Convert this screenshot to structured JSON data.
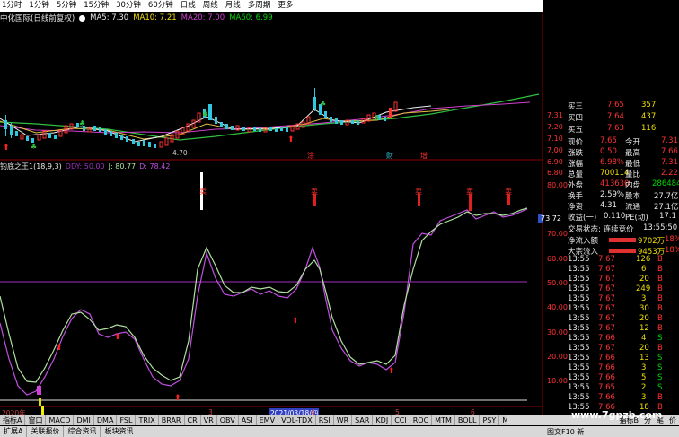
{
  "periods": [
    "1分时",
    "1分钟",
    "5分钟",
    "15分钟",
    "30分钟",
    "60分钟",
    "日线",
    "周线",
    "月线",
    "多周期",
    "更多"
  ],
  "info_line": {
    "title": "中化国际(日线前复权)",
    "ma5": "MA5: 7.30",
    "ma10": "MA10: 7.21",
    "ma20": "MA20: 7.00",
    "ma60": "MA60: 6.99",
    "low_label": "4.70"
  },
  "indicator_line": {
    "name": "钓底之王1(18,9,3)",
    "ddy": "DDY: 50.00",
    "j": "J: 80.77",
    "d": "D: 78.42"
  },
  "sell_label": "卖",
  "buy_label": "买",
  "marks": {
    "tuo": "涂",
    "cai": "财",
    "zeng": "增"
  },
  "price_axis": [
    "7.31",
    "7.20",
    "7.10",
    "7.00",
    "6.90",
    "6.80"
  ],
  "ind_axis": [
    "80.00",
    "73.72",
    "70.00",
    "60.00",
    "50.00",
    "40.00",
    "30.00",
    "20.00",
    "10.00"
  ],
  "time_axis": {
    "year": "2020年",
    "date": "2021/03/18/四",
    "ticks": [
      "3",
      "4",
      "5",
      "6"
    ]
  },
  "quote": {
    "rows": [
      {
        "label": "买三",
        "price": "7.65",
        "vol": "357"
      },
      {
        "label": "买四",
        "price": "7.64",
        "vol": "437"
      },
      {
        "label": "买五",
        "price": "7.63",
        "vol": "116"
      }
    ],
    "stats": [
      {
        "l1": "现价",
        "v1": "7.65",
        "l2": "今开",
        "v2": "7.31"
      },
      {
        "l1": "涨跌",
        "v1": "0.50",
        "l2": "最高",
        "v2": "7.66"
      },
      {
        "l1": "涨幅",
        "v1": "6.98%",
        "l2": "最低",
        "v2": "7.31"
      },
      {
        "l1": "总量",
        "v1": "700114",
        "l2": "量比",
        "v2": "2.22"
      },
      {
        "l1": "外盘",
        "v1": "413630",
        "l2": "内盘",
        "v2": "286484"
      },
      {
        "l1": "换手",
        "v1": "2.59%",
        "l2": "股本",
        "v2": "27.7亿"
      },
      {
        "l1": "净资",
        "v1": "4.31",
        "l2": "流通",
        "v2": "27.1亿"
      },
      {
        "l1": "收益(一)",
        "v1": "0.110",
        "l2": "PE(动)",
        "v2": "17.1"
      }
    ],
    "trade_status_label": "交易状态: 连续竞价",
    "trade_status_time": "13:55:50",
    "flows": [
      {
        "label": "净流入额",
        "value": "9702万",
        "pct": "18%"
      },
      {
        "label": "大宗流入",
        "value": "9453万",
        "pct": "18%"
      }
    ]
  },
  "trades": [
    {
      "time": "13:55",
      "price": "7.67",
      "vol": "126",
      "side": "B"
    },
    {
      "time": "13:55",
      "price": "7.67",
      "vol": "6",
      "side": "B"
    },
    {
      "time": "13:55",
      "price": "7.67",
      "vol": "20",
      "side": "B"
    },
    {
      "time": "13:55",
      "price": "7.67",
      "vol": "249",
      "side": "B"
    },
    {
      "time": "13:55",
      "price": "7.67",
      "vol": "3",
      "side": "B"
    },
    {
      "time": "13:55",
      "price": "7.67",
      "vol": "30",
      "side": "B"
    },
    {
      "time": "13:55",
      "price": "7.67",
      "vol": "20",
      "side": "B"
    },
    {
      "time": "13:55",
      "price": "7.67",
      "vol": "12",
      "side": "B"
    },
    {
      "time": "13:55",
      "price": "7.66",
      "vol": "4",
      "side": "S"
    },
    {
      "time": "13:55",
      "price": "7.67",
      "vol": "20",
      "side": "B"
    },
    {
      "time": "13:55",
      "price": "7.66",
      "vol": "13",
      "side": "S"
    },
    {
      "time": "13:55",
      "price": "7.66",
      "vol": "3",
      "side": "S"
    },
    {
      "time": "13:55",
      "price": "7.66",
      "vol": "5",
      "side": "S"
    },
    {
      "time": "13:55",
      "price": "7.65",
      "vol": "2",
      "side": "S"
    },
    {
      "time": "13:55",
      "price": "7.66",
      "vol": "3",
      "side": "B"
    },
    {
      "time": "13:55",
      "price": "7.66",
      "vol": "18",
      "side": "B"
    }
  ],
  "indicator_tabs": [
    "指标A",
    "窗口",
    "MACD",
    "DMI",
    "DMA",
    "FSL",
    "TRIX",
    "BRAR",
    "CR",
    "VR",
    "OBV",
    "ASI",
    "EMV",
    "VOL-TDX",
    "RSI",
    "WR",
    "SAR",
    "KDJ",
    "CCI",
    "ROC",
    "MTM",
    "BOLL",
    "PSY",
    "MCST",
    "更多",
    "设置"
  ],
  "bottom_tabs": [
    "扩展A",
    "关联报价",
    "综合资讯",
    "板块资讯"
  ],
  "right_tabs": [
    "指标B",
    "分",
    "笔",
    "价"
  ],
  "right_tabs2": "图文F10 新",
  "watermark": "www.7gpzb.com",
  "colors": {
    "background": "#000000",
    "up": "#ff3232",
    "down": "#00d800",
    "k_line": "#e0e0e0",
    "d_line": "#c050e0",
    "ddy_line": "#a030c0"
  }
}
